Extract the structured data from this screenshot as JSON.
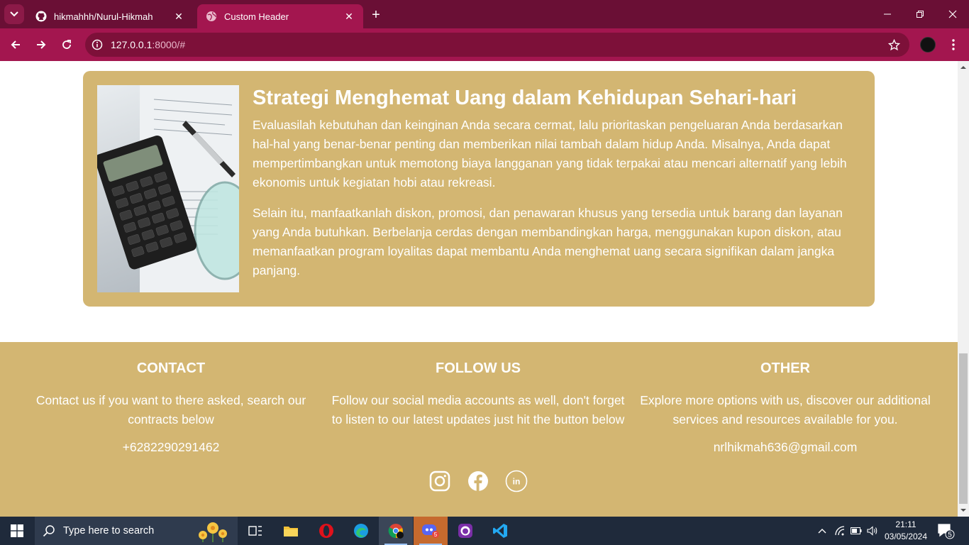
{
  "browser": {
    "tabs": [
      {
        "label": "hikmahhh/Nurul-Hikmah",
        "icon": "github-icon",
        "active": false
      },
      {
        "label": "Custom Header",
        "icon": "globe-icon",
        "active": true
      }
    ],
    "url_host": "127.0.0.1",
    "url_rest": ":8000/#"
  },
  "article": {
    "title": "Strategi Menghemat Uang dalam Kehidupan Sehari-hari",
    "paragraph1": "Evaluasilah kebutuhan dan keinginan Anda secara cermat, lalu prioritaskan pengeluaran Anda berdasarkan hal-hal yang benar-benar penting dan memberikan nilai tambah dalam hidup Anda. Misalnya, Anda dapat mempertimbangkan untuk memotong biaya langganan yang tidak terpakai atau mencari alternatif yang lebih ekonomis untuk kegiatan hobi atau rekreasi.",
    "paragraph2": "Selain itu, manfaatkanlah diskon, promosi, dan penawaran khusus yang tersedia untuk barang dan layanan yang Anda butuhkan. Berbelanja cerdas dengan membandingkan harga, menggunakan kupon diskon, atau memanfaatkan program loyalitas dapat membantu Anda menghemat uang secara signifikan dalam jangka panjang."
  },
  "footer": {
    "contact": {
      "heading": "CONTACT",
      "text": "Contact us if you want to there asked, search our contracts below",
      "phone": "+6282290291462"
    },
    "follow": {
      "heading": "FOLLOW US",
      "text": "Follow our social media accounts as well, don't forget to listen to our latest updates just hit the button below",
      "socials": [
        "instagram-icon",
        "facebook-icon",
        "linkedin-icon"
      ]
    },
    "other": {
      "heading": "OTHER",
      "text": "Explore more options with us, discover our additional services and resources available for you.",
      "email": "nrlhikmah636@gmail.com"
    }
  },
  "taskbar": {
    "search_placeholder": "Type here to search",
    "time": "21:11",
    "date": "03/05/2024",
    "notification_count": "5",
    "discord_badge": "5"
  },
  "colors": {
    "tabbar": "#6a0f35",
    "toolbar": "#a3164f",
    "card": "#d3b672",
    "footer": "#d3b672",
    "taskbar": "#1f2a3b"
  }
}
